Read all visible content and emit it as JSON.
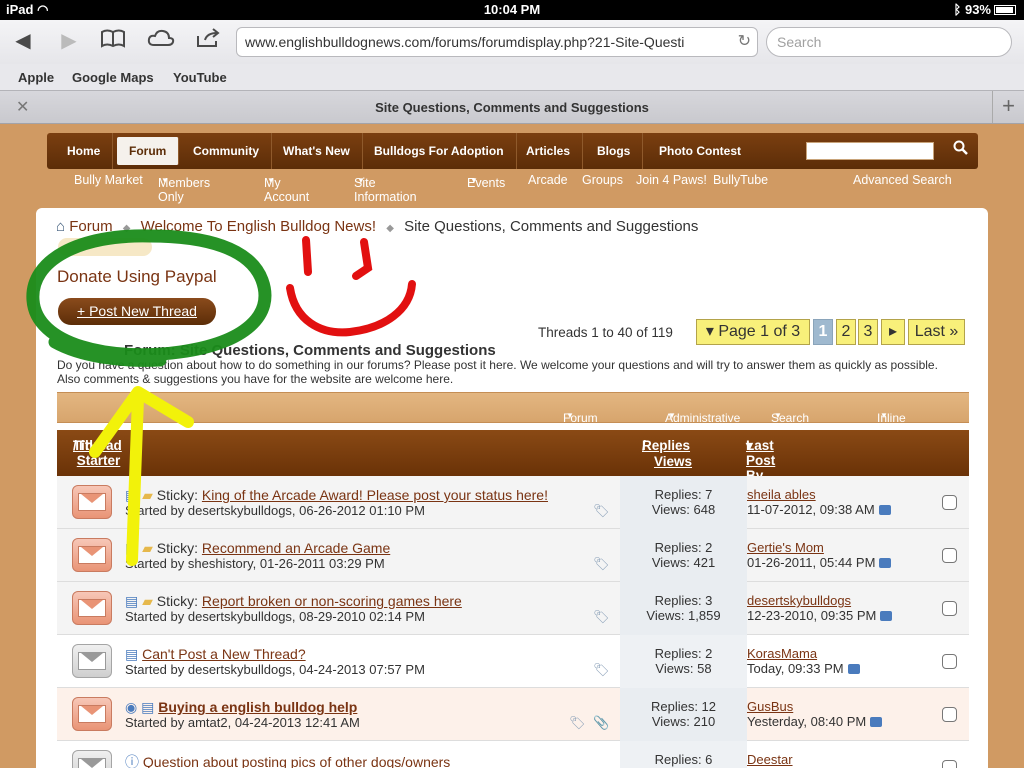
{
  "status": {
    "device": "iPad",
    "time": "10:04 PM",
    "battery": "93%"
  },
  "browser": {
    "url": "www.englishbulldognews.com/forums/forumdisplay.php?21-Site-Questi",
    "search_placeholder": "Search",
    "bookmarks": [
      "Apple",
      "Google Maps",
      "YouTube"
    ],
    "tab_title": "Site Questions, Comments and Suggestions"
  },
  "nav": {
    "items": [
      "Home",
      "Forum",
      "Community",
      "What's New",
      "Bulldogs For Adoption",
      "Articles",
      "Blogs",
      "Photo Contest"
    ],
    "sub": [
      "Bully Market",
      "Members Only",
      "My Account",
      "Site Information",
      "Events",
      "Arcade",
      "Groups",
      "Join 4 Paws!",
      "BullyTube"
    ],
    "advanced_search": "Advanced Search"
  },
  "breadcrumb": [
    "Forum",
    "Welcome To English Bulldog News!",
    "Site Questions, Comments and Suggestions"
  ],
  "donate": "Donate Using Paypal",
  "post_new_thread": "+ Post New Thread",
  "thread_count": "Threads 1 to 40 of 119",
  "pager": {
    "label": "Page 1 of 3",
    "pages": [
      "1",
      "2",
      "3"
    ],
    "next": "▸",
    "last": "Last"
  },
  "forum": {
    "title": "Forum: Site Questions, Comments and Suggestions",
    "description": "Do you have a question about how to do something in our forums? Please post it here. We welcome your questions and will try to answer them as quickly as possible. Also comments & suggestions you have for the website are welcome here."
  },
  "tools": [
    "Forum Tools",
    "Administrative",
    "Search Forum",
    "Inline Mod"
  ],
  "headers": {
    "title": "Title",
    "starter": "Thread Starter",
    "replies": "Replies",
    "views": "Views",
    "last_post": "Last Post By"
  },
  "threads": [
    {
      "prefix": "Sticky:",
      "title": "King of the Arcade Award! Please post your status here!",
      "starter": "Started by desertskybulldogs, 06-26-2012 01:10 PM",
      "replies": "Replies: 7",
      "views": "Views: 648",
      "last_by": "sheila ables",
      "last_date": "11-07-2012, 09:38 AM"
    },
    {
      "prefix": "Sticky:",
      "title": "Recommend an Arcade Game",
      "starter": "Started by sheshistory, 01-26-2011 03:29 PM",
      "replies": "Replies: 2",
      "views": "Views: 421",
      "last_by": "Gertie's Mom",
      "last_date": "01-26-2011, 05:44 PM"
    },
    {
      "prefix": "Sticky:",
      "title": "Report broken or non-scoring games here",
      "starter": "Started by desertskybulldogs, 08-29-2010 02:14 PM",
      "replies": "Replies: 3",
      "views": "Views: 1,859",
      "last_by": "desertskybulldogs",
      "last_date": "12-23-2010, 09:35 PM"
    },
    {
      "prefix": "",
      "title": "Can't Post a New Thread?",
      "starter": "Started by desertskybulldogs, 04-24-2013 07:57 PM",
      "replies": "Replies: 2",
      "views": "Views: 58",
      "last_by": "KorasMama",
      "last_date": "Today, 09:33 PM"
    },
    {
      "prefix": "",
      "title": "Buying a english bulldog help",
      "starter": "Started by amtat2, 04-24-2013 12:41 AM",
      "replies": "Replies: 12",
      "views": "Views: 210",
      "last_by": "GusBus",
      "last_date": "Yesterday, 08:40 PM"
    },
    {
      "prefix": "",
      "title": "Question about posting pics of other dogs/owners",
      "starter": "",
      "replies": "Replies: 6",
      "views": "",
      "last_by": "Deestar",
      "last_date": ""
    }
  ]
}
